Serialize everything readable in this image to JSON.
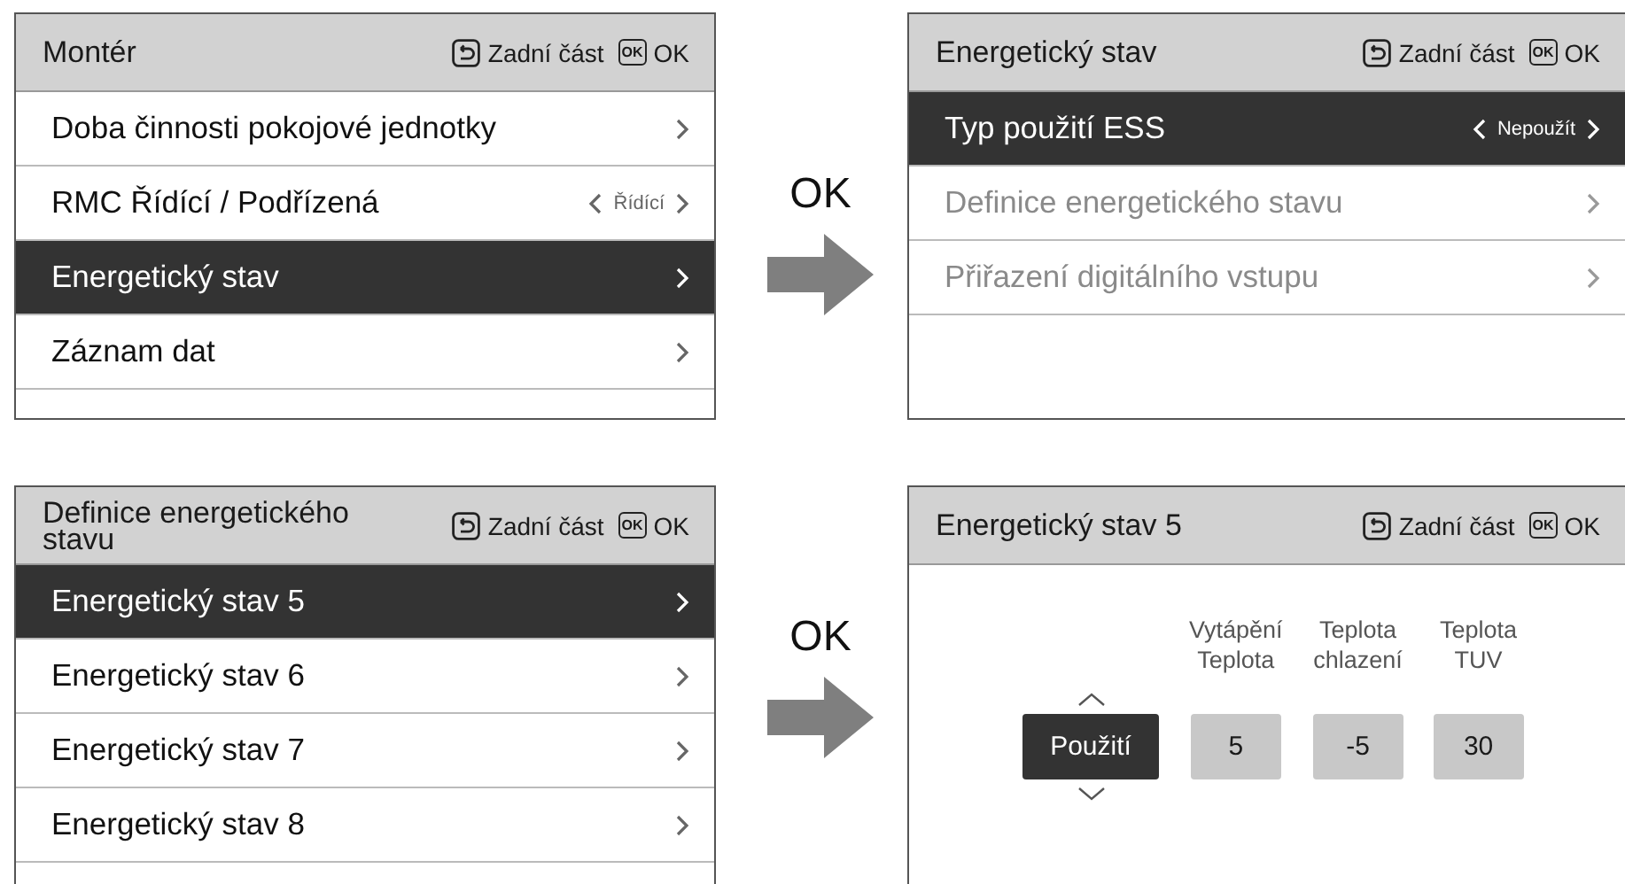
{
  "steps": [
    {
      "from": {
        "title": "Montér",
        "back_label": "Zadní část",
        "ok_key": "OK",
        "ok_label": "OK",
        "kind": "menu",
        "items": [
          {
            "label": "Doba činnosti pokojové jednotky",
            "kind": "nav",
            "selected": false,
            "disabled": false
          },
          {
            "label": "RMC Řídící / Podřízená",
            "kind": "value",
            "value": "Řídící",
            "selected": false,
            "disabled": false
          },
          {
            "label": "Energetický stav",
            "kind": "nav",
            "selected": true,
            "disabled": false
          },
          {
            "label": "Záznam dat",
            "kind": "nav",
            "selected": false,
            "disabled": false
          }
        ]
      },
      "action": "OK",
      "to": {
        "title": "Energetický stav",
        "back_label": "Zadní část",
        "ok_key": "OK",
        "ok_label": "OK",
        "kind": "menu",
        "items": [
          {
            "label": "Typ použití ESS",
            "kind": "value",
            "value": "Nepoužít",
            "selected": true,
            "disabled": false
          },
          {
            "label": "Definice energetického stavu",
            "kind": "nav",
            "selected": false,
            "disabled": true
          },
          {
            "label": "Přiřazení digitálního vstupu",
            "kind": "nav",
            "selected": false,
            "disabled": true
          }
        ]
      }
    },
    {
      "from": {
        "title": "Definice energetického stavu",
        "back_label": "Zadní část",
        "ok_key": "OK",
        "ok_label": "OK",
        "kind": "menu",
        "items": [
          {
            "label": "Energetický stav 5",
            "kind": "nav",
            "selected": true,
            "disabled": false
          },
          {
            "label": "Energetický stav 6",
            "kind": "nav",
            "selected": false,
            "disabled": false
          },
          {
            "label": "Energetický stav 7",
            "kind": "nav",
            "selected": false,
            "disabled": false
          },
          {
            "label": "Energetický stav 8",
            "kind": "nav",
            "selected": false,
            "disabled": false
          }
        ]
      },
      "action": "OK",
      "to": {
        "title": "Energetický stav 5",
        "back_label": "Zadní část",
        "ok_key": "OK",
        "ok_label": "OK",
        "kind": "editor",
        "fields": [
          {
            "kind": "option",
            "value": "Použití",
            "selected": true
          },
          {
            "kind": "number",
            "header": [
              "Vytápění",
              "Teplota"
            ],
            "value": "5",
            "selected": false
          },
          {
            "kind": "number",
            "header": [
              "Teplota",
              "chlazení"
            ],
            "value": "-5",
            "selected": false
          },
          {
            "kind": "number",
            "header": [
              "Teplota",
              "TUV"
            ],
            "value": "30",
            "selected": false
          }
        ]
      }
    }
  ]
}
